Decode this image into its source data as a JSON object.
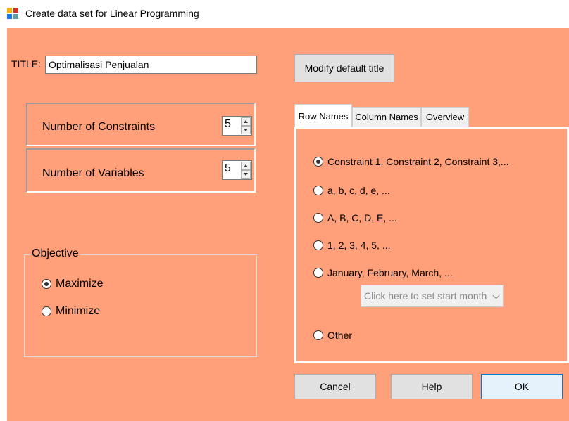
{
  "window": {
    "title": "Create data set for Linear Programming",
    "icon": "form-window-icon"
  },
  "title_field": {
    "label": "TITLE:",
    "value": "Optimalisasi Penjualan"
  },
  "buttons": {
    "modify_title": "Modify default title",
    "cancel": "Cancel",
    "help": "Help",
    "ok": "OK"
  },
  "constraints": {
    "label": "Number of Constraints",
    "value": "5"
  },
  "variables": {
    "label": "Number of Variables",
    "value": "5"
  },
  "objective": {
    "legend": "Objective",
    "options": [
      "Maximize",
      "Minimize"
    ],
    "selected": "Maximize"
  },
  "tabs": [
    "Row Names",
    "Column Names",
    "Overview"
  ],
  "active_tab": "Row Names",
  "row_names": {
    "options": [
      "Constraint 1, Constraint 2, Constraint 3,...",
      "a, b, c, d, e, ...",
      "A, B, C, D, E, ...",
      "1, 2, 3, 4, 5, ...",
      "January, February, March, ...",
      "Other"
    ],
    "selected": "Constraint 1, Constraint 2, Constraint 3,...",
    "month_placeholder": "Click here to set start month"
  },
  "colors": {
    "background": "#FFA07A"
  }
}
